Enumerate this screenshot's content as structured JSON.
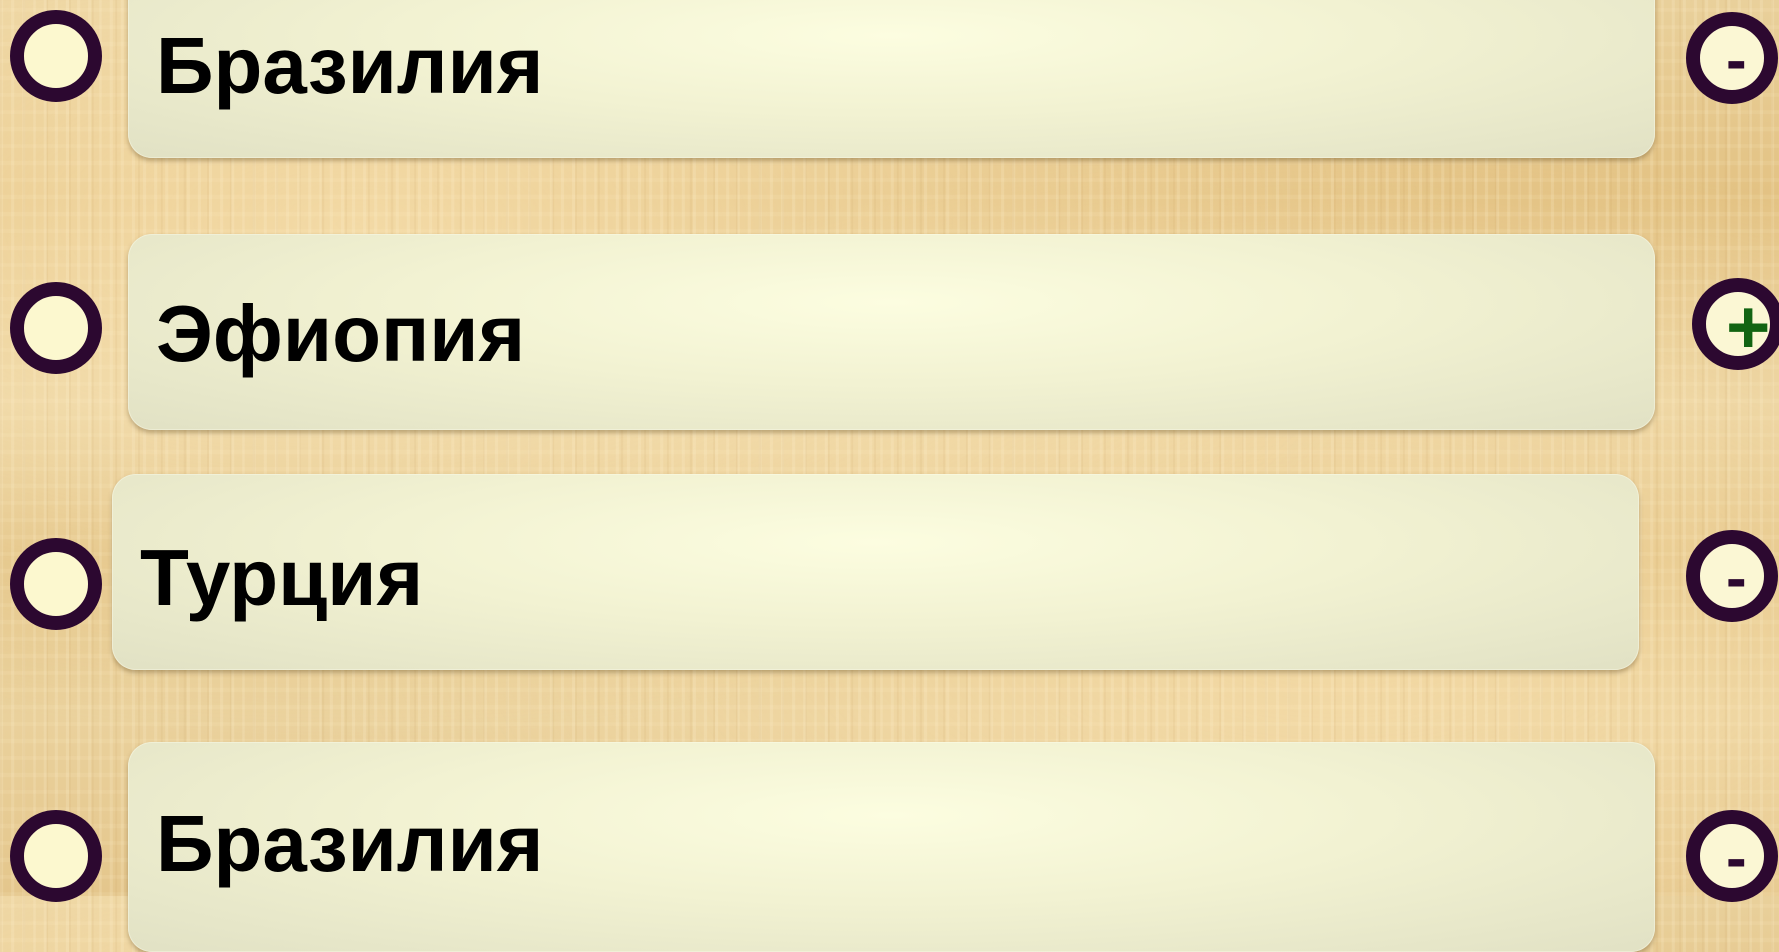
{
  "quiz": {
    "options": [
      {
        "label": "Бразилия",
        "mark": "-",
        "mark_color": "#2c0830",
        "result": "incorrect"
      },
      {
        "label": "Эфиопия",
        "mark": "+",
        "mark_color": "#126412",
        "result": "correct"
      },
      {
        "label": "Турция",
        "mark": "-",
        "mark_color": "#2c0830",
        "result": "incorrect"
      },
      {
        "label": "Бразилия",
        "mark": "-",
        "mark_color": "#2c0830",
        "result": "incorrect"
      }
    ]
  },
  "colors": {
    "bullet_ring": "#2c0830",
    "bullet_fill": "#fcf8cf",
    "card_light": "#fcfde0",
    "card_dark": "#e1e1c4",
    "background": "#e8cc93",
    "text": "#000000"
  },
  "icons": {
    "bullet": "radio-bullet-icon",
    "minus_marker": "minus-circle-icon",
    "plus_marker": "plus-circle-icon"
  }
}
